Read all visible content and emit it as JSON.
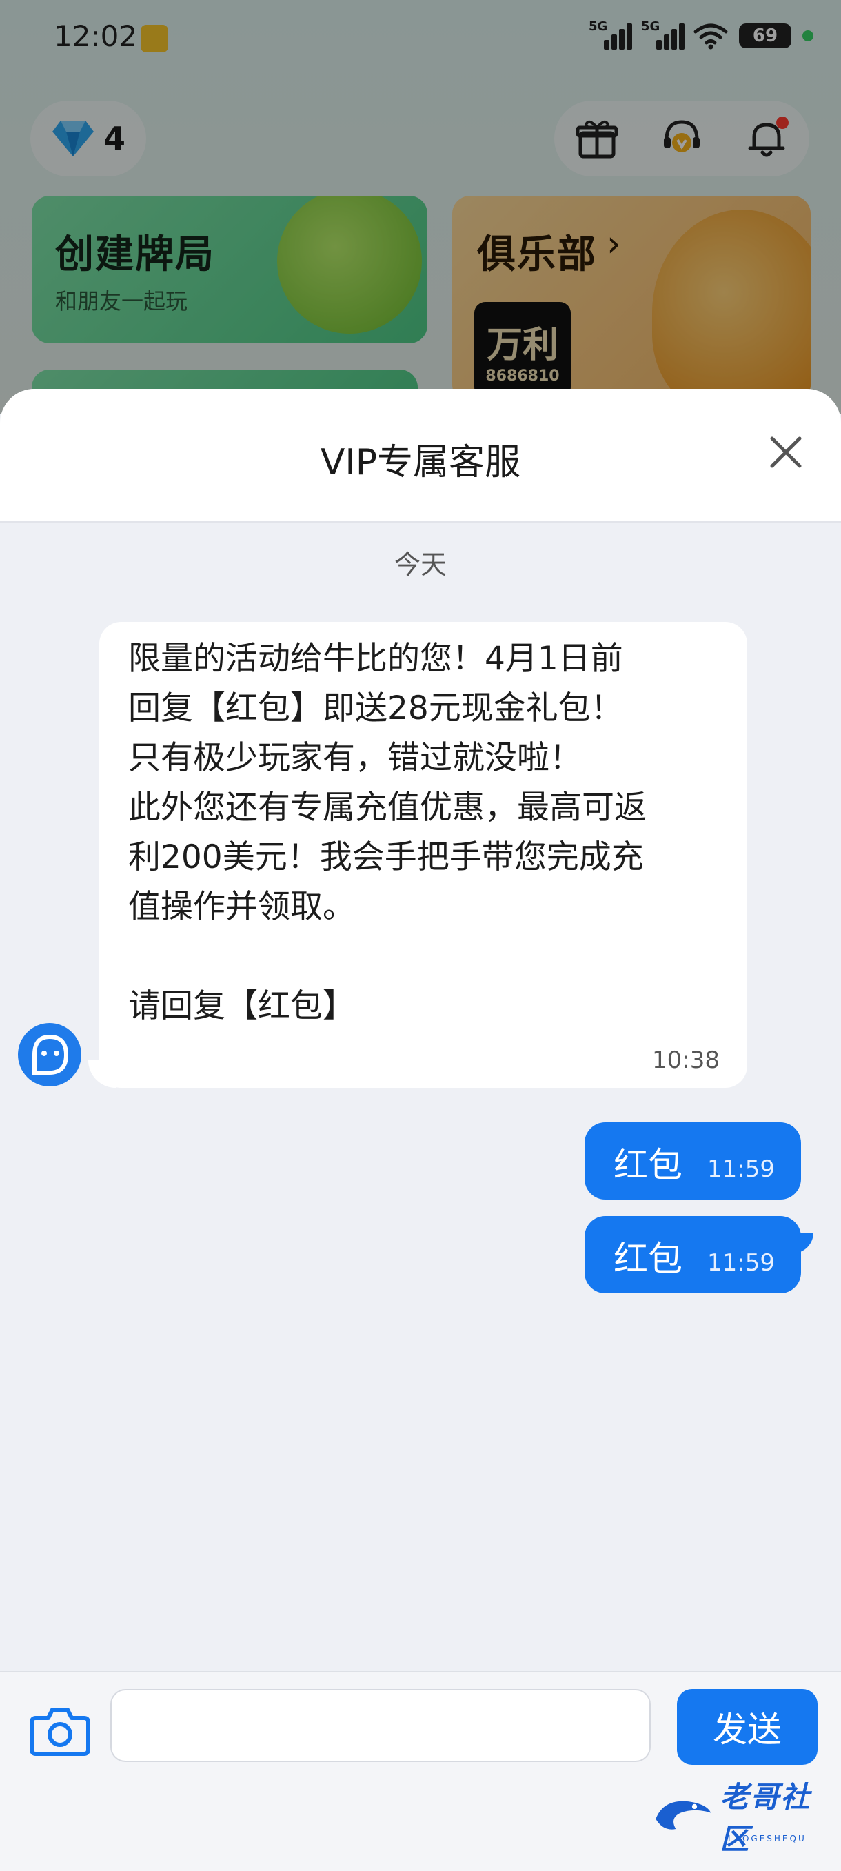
{
  "status_bar": {
    "time": "12:02",
    "sim1_label": "5G",
    "sim2_label": "5G",
    "battery": "69",
    "icons": [
      "app-notification-icon",
      "signal-icon",
      "signal-icon",
      "wifi-icon",
      "battery-icon"
    ]
  },
  "background_app": {
    "gem_count": "4",
    "top_icons": [
      "gift-icon",
      "customer-service-icon",
      "bell-icon"
    ],
    "create_card": {
      "title": "创建牌局",
      "subtitle": "和朋友一起玩"
    },
    "club_card": {
      "title": "俱乐部",
      "thumb_title": "万利",
      "thumb_number": "8686810"
    }
  },
  "chat": {
    "title": "VIP专属客服",
    "date_separator": "今天",
    "incoming": {
      "text": "限量的活动给牛比的您！4月1日前\n回复【红包】即送28元现金礼包！\n只有极少玩家有，错过就没啦！\n此外您还有专属充值优惠，最高可返\n利200美元！我会手把手带您完成充\n值操作并领取。\n\n请回复【红包】",
      "time": "10:38"
    },
    "outgoing": [
      {
        "text": "红包",
        "time": "11:59"
      },
      {
        "text": "红包",
        "time": "11:59"
      }
    ]
  },
  "input_bar": {
    "input_value": "",
    "send_label": "发送"
  },
  "watermark": {
    "text": "老哥社区",
    "sub": "LAOGESHEQU"
  },
  "colors": {
    "accent": "#1578f0",
    "chat_background": "#eef0f5",
    "incoming_bubble": "#ffffff",
    "create_card": "#4fcb87",
    "club_card": "#f4b562"
  }
}
